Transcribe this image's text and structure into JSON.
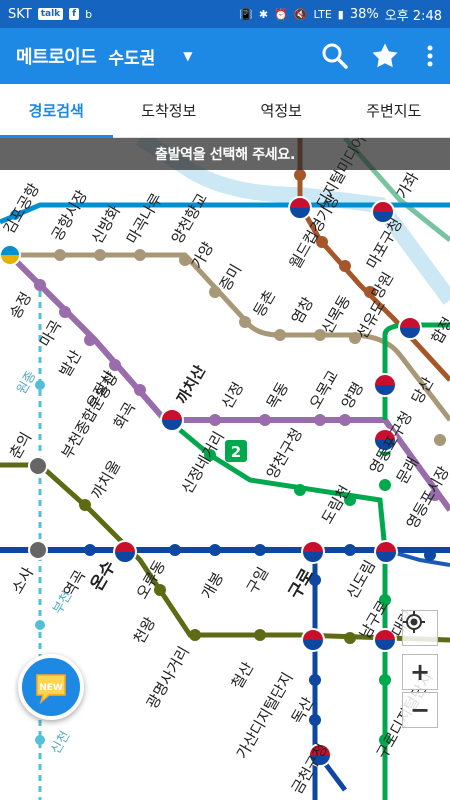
{
  "status_bar": {
    "carrier": "SKT",
    "talk_badge": "talk",
    "fb_icon": "facebook-icon",
    "b_label": "b",
    "network": "LTE",
    "battery": "38%",
    "time": "오후 2:48"
  },
  "app_bar": {
    "title": "메트로이드",
    "region": "수도권",
    "search_icon": "search-icon",
    "favorite_icon": "star-icon",
    "more_icon": "more-vert-icon"
  },
  "tabs": [
    {
      "label": "경로검색",
      "active": true
    },
    {
      "label": "도착정보",
      "active": false
    },
    {
      "label": "역정보",
      "active": false
    },
    {
      "label": "주변지도",
      "active": false
    }
  ],
  "banner": "출발역을 선택해 주세요.",
  "map": {
    "line_badge": "2",
    "stations": [
      "김포공항",
      "공항시장",
      "신방화",
      "마곡나루",
      "양천향교",
      "가양",
      "증미",
      "등촌",
      "염창",
      "신목동",
      "선유도",
      "당산",
      "합정",
      "망원",
      "마포구청",
      "월드컵경기장",
      "디지털미디어시티",
      "가좌",
      "송정",
      "마곡",
      "발산",
      "우장산",
      "화곡",
      "까치산",
      "신정",
      "목동",
      "오목교",
      "양평",
      "영등포구청",
      "영등포시장",
      "문래",
      "신정네거리",
      "양천구청",
      "도림천",
      "신도림",
      "부천종합운동장",
      "까치울",
      "춘의",
      "원종",
      "소사",
      "역곡",
      "온수",
      "오류동",
      "개봉",
      "구일",
      "구로",
      "천왕",
      "광명사거리",
      "철산",
      "가산디지털단지",
      "남구로",
      "대림",
      "구로디지털단지",
      "독산",
      "금천구청",
      "부천",
      "신천"
    ],
    "zoom_in": "+",
    "zoom_out": "−",
    "new_badge": "NEW"
  },
  "colors": {
    "primary": "#1e88e5",
    "status_bar": "#1565c0",
    "line_1": "#0d47a1",
    "line_2": "#00a84d",
    "line_5": "#996cac",
    "line_6": "#cd7c2f",
    "line_7": "#747f00",
    "line_9": "#bdb092",
    "airport": "#0090d2",
    "line_gyeongui": "#77c4a3",
    "seohae": "#8fc31f"
  }
}
